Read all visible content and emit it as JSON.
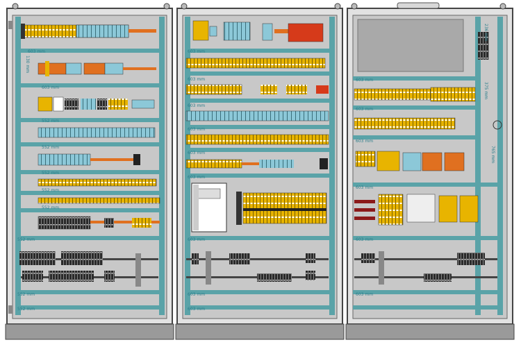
{
  "drawing": {
    "cabinets": [
      {
        "name": "left",
        "dimension_labels": [
          "603 mm",
          "603 mm",
          "552 mm",
          "552 mm",
          "552 mm",
          "552 mm",
          "552 mm",
          "552 mm",
          "552 mm",
          "552 mm"
        ],
        "vertical_labels": [
          "130 mm"
        ]
      },
      {
        "name": "middle",
        "dimension_labels": [
          "603 mm",
          "603 mm",
          "603 mm",
          "603 mm",
          "603 mm",
          "603 mm",
          "603 mm",
          "603 mm",
          "603 mm"
        ]
      },
      {
        "name": "right",
        "dimension_labels": [
          "603 mm",
          "603 mm",
          "603 mm",
          "603 mm",
          "603 mm",
          "603 mm"
        ],
        "vertical_labels": [
          "236 mm",
          "375 mm",
          "765 mm"
        ]
      }
    ]
  },
  "colors": {
    "frame": "#555555",
    "backplate": "#c8c8c8",
    "duct": "#5aa3a8",
    "component_yellow": "#e8b400",
    "component_orange": "#e07020",
    "component_red": "#d63a1a",
    "component_blue": "#8cc8d8",
    "terminal_black": "#222222",
    "measure": "#2a7d8a",
    "cable_red": "#8b1a1a"
  }
}
